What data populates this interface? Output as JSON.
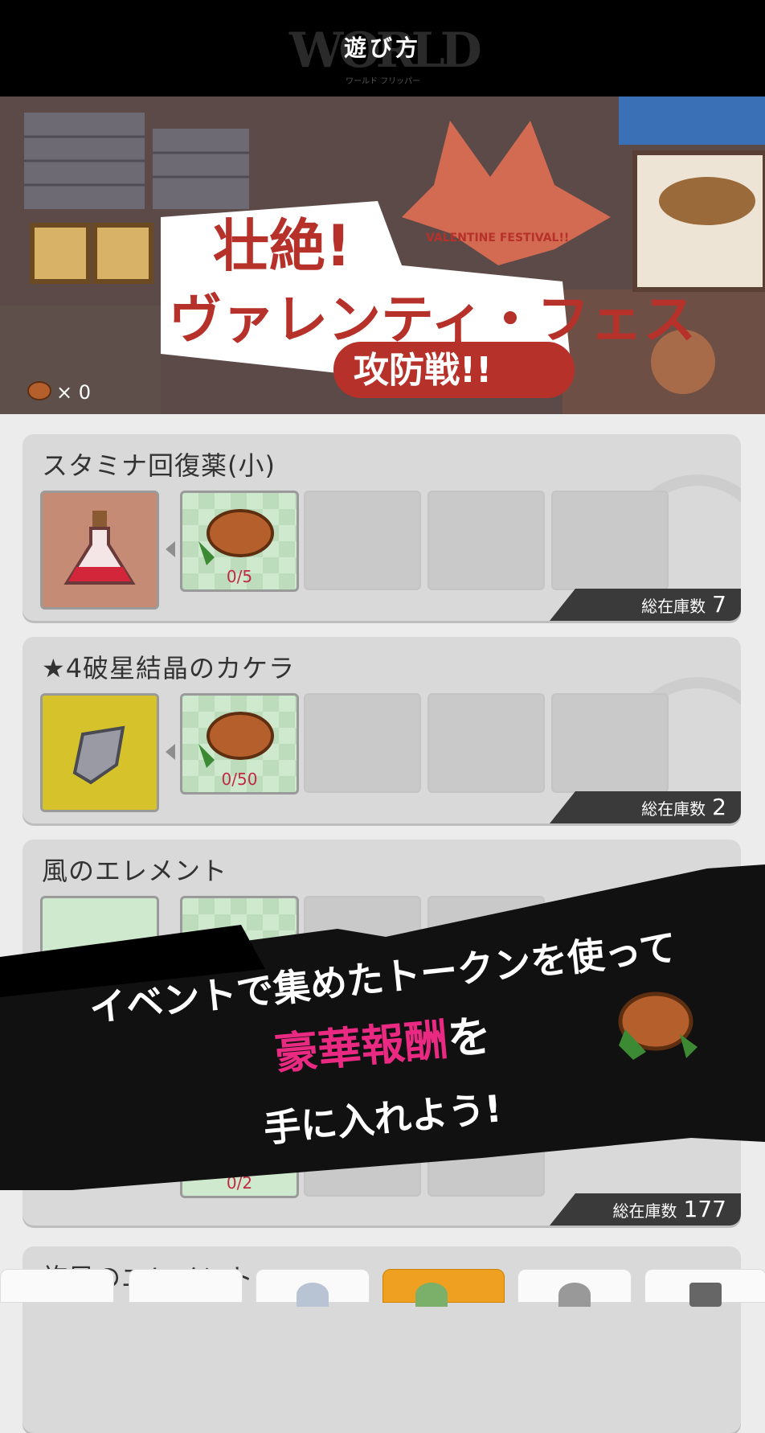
{
  "header": {
    "title": "遊び方",
    "logo_text": "WORLD FLIPPER",
    "logo_sub": "ワールド フリッパー"
  },
  "banner": {
    "event_title_line1": "壮絶!",
    "event_title_line2": "ヴァレンティ・フェス",
    "event_title_line3": "攻防戦!!",
    "event_subtitle": "VALENTINE FESTIVAL!!",
    "token_count": "× 0"
  },
  "items": [
    {
      "name": "スタミナ回復薬(小)",
      "cost": "0/5",
      "stock_label": "総在庫数",
      "stock": "7"
    },
    {
      "name": "★4破星結晶のカケラ",
      "cost": "0/50",
      "stock_label": "総在庫数",
      "stock": "2"
    },
    {
      "name": "風のエレメント",
      "cost": "0/2",
      "stock_label": "総在庫数",
      "stock": "177"
    },
    {
      "name": "旋風のエレメント"
    }
  ],
  "promo": {
    "line1": "イベントで集めたトークンを使って",
    "line2_highlight": "豪華報酬",
    "line2_rest": "を",
    "line3": "手に入れよう!"
  },
  "colors": {
    "accent": "#ea2a82",
    "cost_red": "#c22a43",
    "token_brown": "#b5602c"
  }
}
